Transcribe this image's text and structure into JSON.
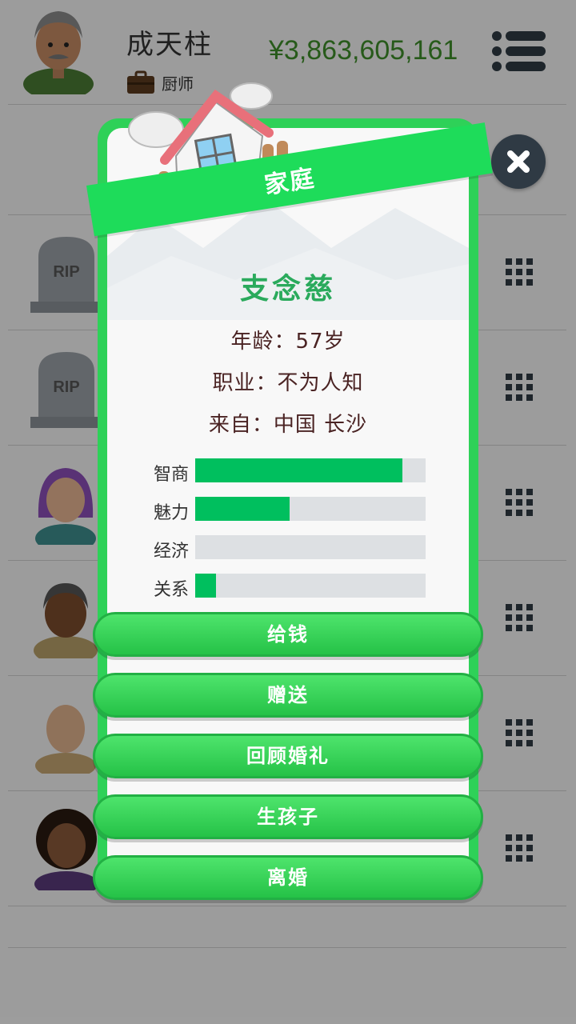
{
  "player": {
    "name": "成天柱",
    "job": "厨师",
    "money": "¥3,863,605,161"
  },
  "rows": [
    {
      "type": "tombstone",
      "label": "RIP"
    },
    {
      "type": "tombstone",
      "label": "RIP"
    },
    {
      "type": "person",
      "icon": "purple-hair-woman-avatar"
    },
    {
      "type": "person",
      "icon": "old-man-avatar"
    },
    {
      "type": "person",
      "icon": "bald-man-avatar"
    },
    {
      "type": "person",
      "icon": "curly-hair-woman-avatar"
    }
  ],
  "modal": {
    "title": "家庭",
    "person_name": "支念慈",
    "age": "年龄：57岁",
    "occupation": "职业：不为人知",
    "origin": "来自：中国 长沙",
    "stats": [
      {
        "label": "智商",
        "value": 0.9
      },
      {
        "label": "魅力",
        "value": 0.41
      },
      {
        "label": "经济",
        "value": 0.0
      },
      {
        "label": "关系",
        "value": 0.09
      }
    ],
    "buttons": [
      "给钱",
      "赠送",
      "回顾婚礼",
      "生孩子",
      "离婚"
    ]
  },
  "colors": {
    "accent_green": "#1edc5a",
    "bar_green": "#00bf5e",
    "money_green": "#3e8e2a"
  }
}
